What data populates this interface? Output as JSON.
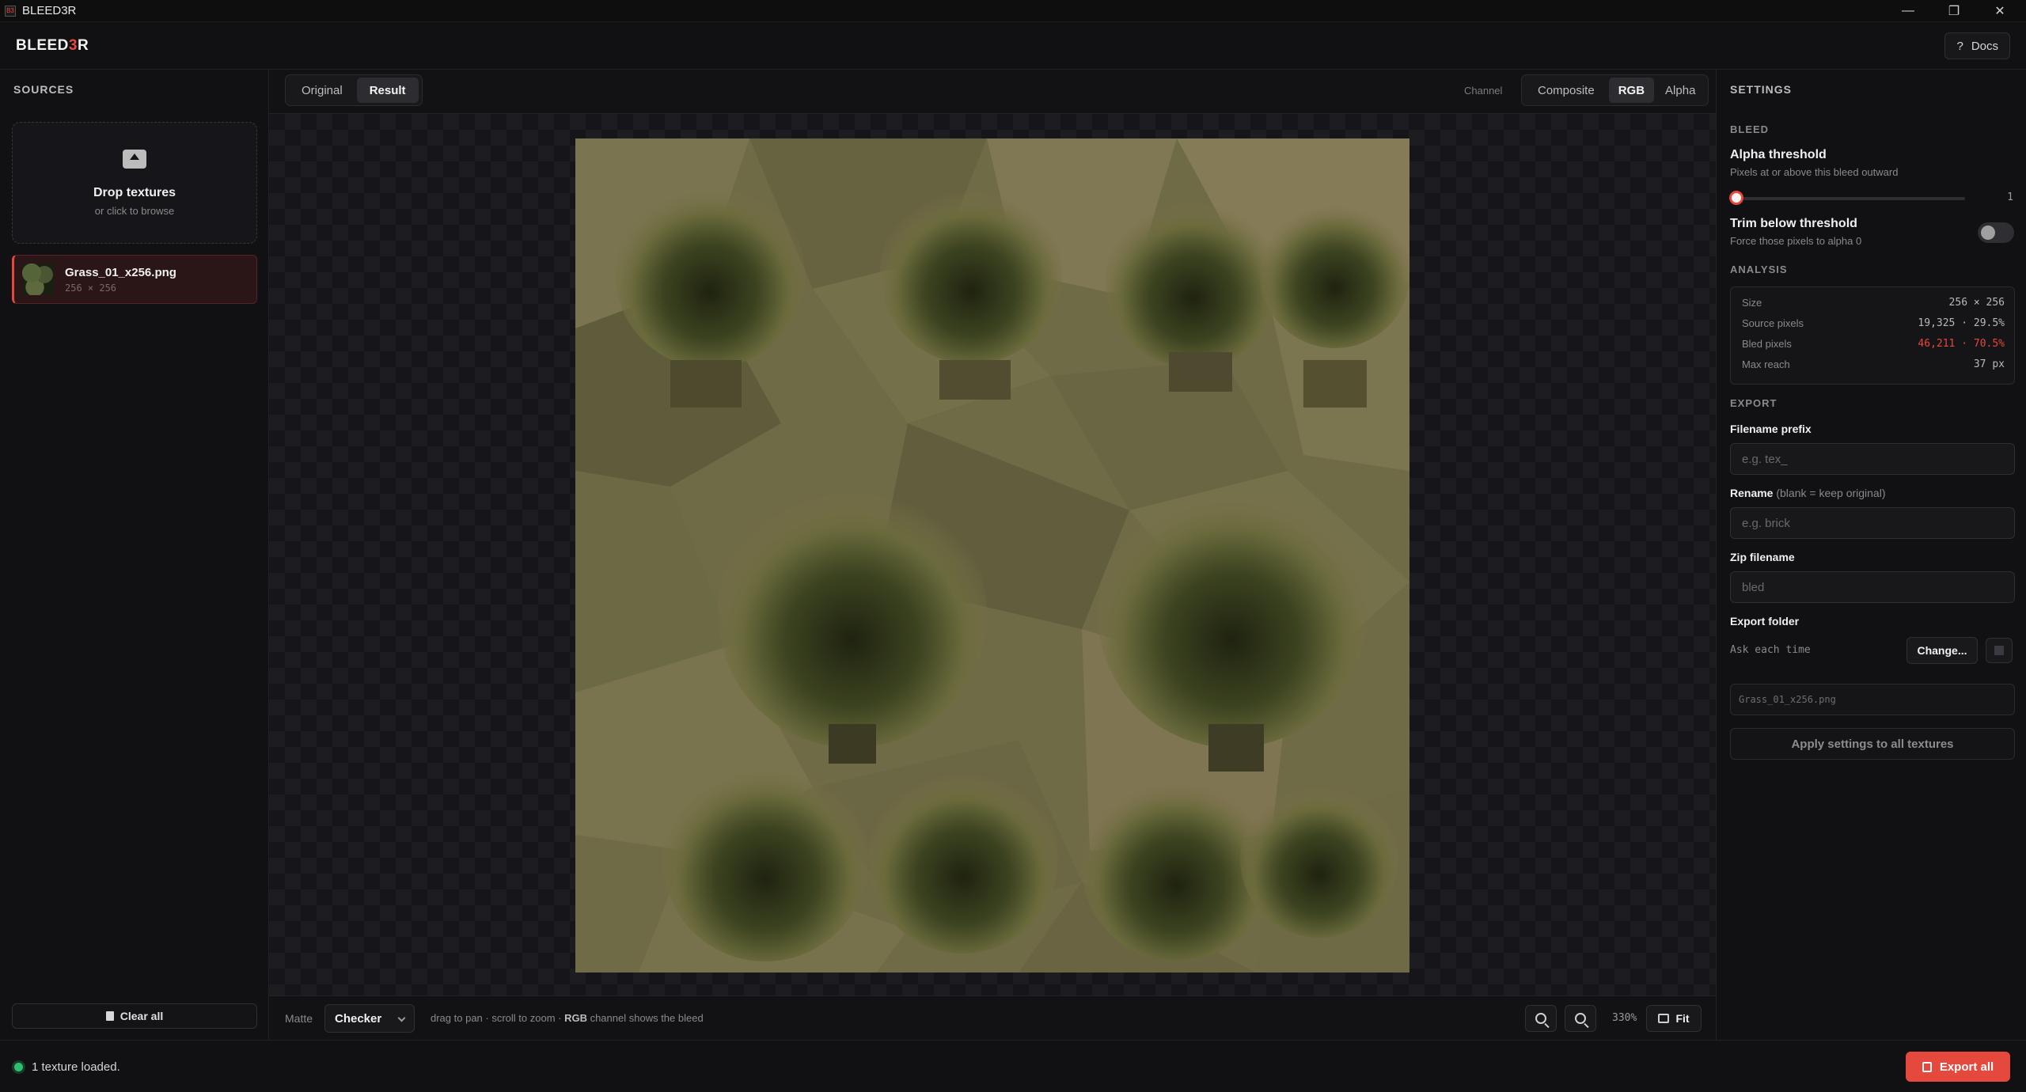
{
  "window": {
    "title": "BLEED3R",
    "icon_label": "B3"
  },
  "header": {
    "logo_pre": "BLEED",
    "logo_accent": "3",
    "logo_post": "R",
    "docs_label": "Docs",
    "docs_icon": "?"
  },
  "sidebar": {
    "title": "SOURCES",
    "dropzone": {
      "title": "Drop textures",
      "subtitle": "or click to browse",
      "icon": "upload-icon"
    },
    "files": [
      {
        "name": "Grass_01_x256.png",
        "size": "256 × 256"
      }
    ],
    "clear_label": "Clear all"
  },
  "view": {
    "tabs": [
      {
        "label": "Original",
        "active": false
      },
      {
        "label": "Result",
        "active": true
      }
    ],
    "channel_label": "Channel",
    "channels": [
      {
        "label": "Composite",
        "active": false
      },
      {
        "label": "RGB",
        "active": true
      },
      {
        "label": "Alpha",
        "active": false
      }
    ],
    "matte_label": "Matte",
    "matte_value": "Checker",
    "hint_pre": "drag to pan · scroll to zoom · ",
    "hint_bold": "RGB",
    "hint_post": " channel shows the bleed",
    "zoom_level": "330%",
    "fit_label": "Fit"
  },
  "settings": {
    "title": "SETTINGS",
    "bleed_section": "BLEED",
    "alpha_threshold_label": "Alpha threshold",
    "alpha_threshold_sub": "Pixels at or above this bleed outward",
    "alpha_threshold_value": "1",
    "trim_label": "Trim below threshold",
    "trim_sub": "Force those pixels to alpha 0",
    "trim_enabled": false,
    "analysis_section": "ANALYSIS",
    "analysis": [
      {
        "key": "Size",
        "value": "256 × 256",
        "highlight": false
      },
      {
        "key": "Source pixels",
        "value": "19,325 · 29.5%",
        "highlight": false
      },
      {
        "key": "Bled pixels",
        "value": "46,211 · 70.5%",
        "highlight": true
      },
      {
        "key": "Max reach",
        "value": "37 px",
        "highlight": false
      }
    ],
    "export_section": "EXPORT",
    "prefix_label": "Filename prefix",
    "prefix_placeholder": "e.g. tex_",
    "rename_label": "Rename",
    "rename_hint": "(blank = keep original)",
    "rename_placeholder": "e.g. brick",
    "zip_label": "Zip filename",
    "zip_placeholder": "bled",
    "folder_label": "Export folder",
    "folder_value": "Ask each time",
    "change_label": "Change...",
    "file_preview": "Grass_01_x256.png",
    "apply_label": "Apply settings to all textures"
  },
  "status": {
    "text": "1 texture loaded.",
    "export_label": "Export all"
  },
  "colors": {
    "accent": "#e5483c",
    "ok": "#2fbf71"
  }
}
